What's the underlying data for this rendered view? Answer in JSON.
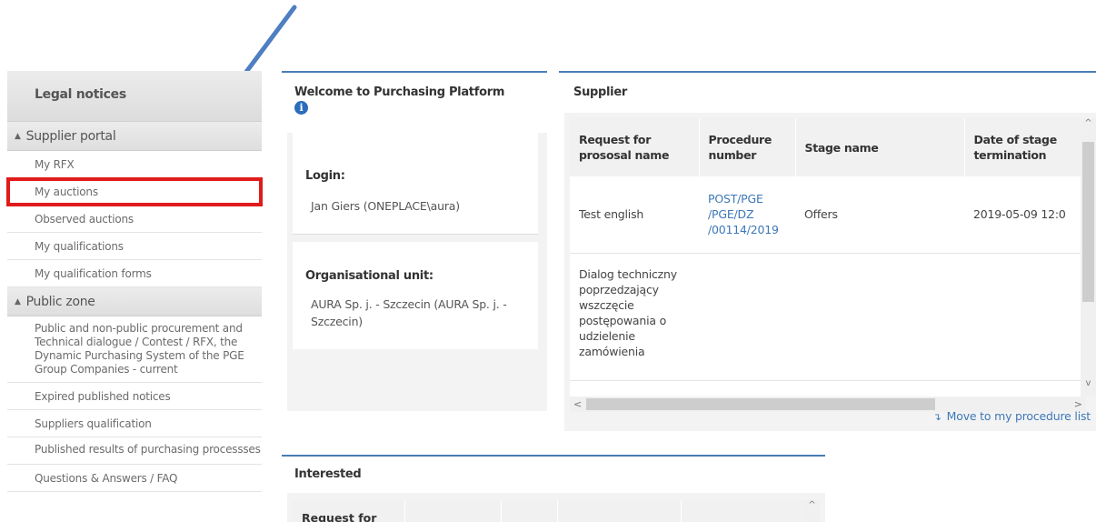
{
  "sidebar": {
    "legal_notices": "Legal notices",
    "supplier_portal": {
      "title": "Supplier portal",
      "items": [
        {
          "label": "My RFX"
        },
        {
          "label": "My auctions"
        },
        {
          "label": "Observed auctions"
        },
        {
          "label": "My qualifications"
        },
        {
          "label": "My qualification forms"
        }
      ]
    },
    "public_zone": {
      "title": "Public zone",
      "items": [
        {
          "label": "Public and non-public procurement and Technical dialogue / Contest / RFX, the Dynamic Purchasing System of the PGE Group Companies - current"
        },
        {
          "label": "Expired published notices"
        },
        {
          "label": "Suppliers qualification"
        },
        {
          "label": "Published results of purchasing processses"
        },
        {
          "label": "Questions & Answers / FAQ"
        }
      ]
    }
  },
  "welcome": {
    "title": "Welcome to Purchasing Platform",
    "login_label": "Login:",
    "login_value": "Jan Giers (ONEPLACE\\aura)",
    "org_label": "Organisational unit:",
    "org_value": "AURA Sp. j. - Szczecin (AURA Sp. j. - Szczecin)"
  },
  "supplier": {
    "title": "Supplier",
    "columns": [
      "Request for prososal name",
      "Procedure number",
      "Stage name",
      "Date of stage termination"
    ],
    "rows": [
      {
        "name": "Test english",
        "procedure": "POST/PGE/PGE/DZ/00114/2019",
        "procedure_lines": [
          "POST/PGE",
          "/PGE/DZ",
          "/00114/2019"
        ],
        "stage": "Offers",
        "date": "2019-05-09 12:0"
      },
      {
        "name": "Dialog techniczny poprzedzający wszczęcie postępowania o udzielenie zamówienia",
        "name_lines": [
          "Dialog techniczny",
          "poprzedzający",
          "wszczęcie",
          "postępowania o",
          "udzielenie",
          "zamówienia"
        ],
        "procedure": "",
        "stage": "",
        "date": ""
      }
    ],
    "move_link": "Move to my procedure list"
  },
  "interested": {
    "title": "Interested",
    "first_column": "Request for"
  },
  "colors": {
    "accent": "#4a7db5",
    "link": "#3d78b8",
    "highlight": "#e01b1b",
    "info_icon": "#2a6ebb"
  }
}
